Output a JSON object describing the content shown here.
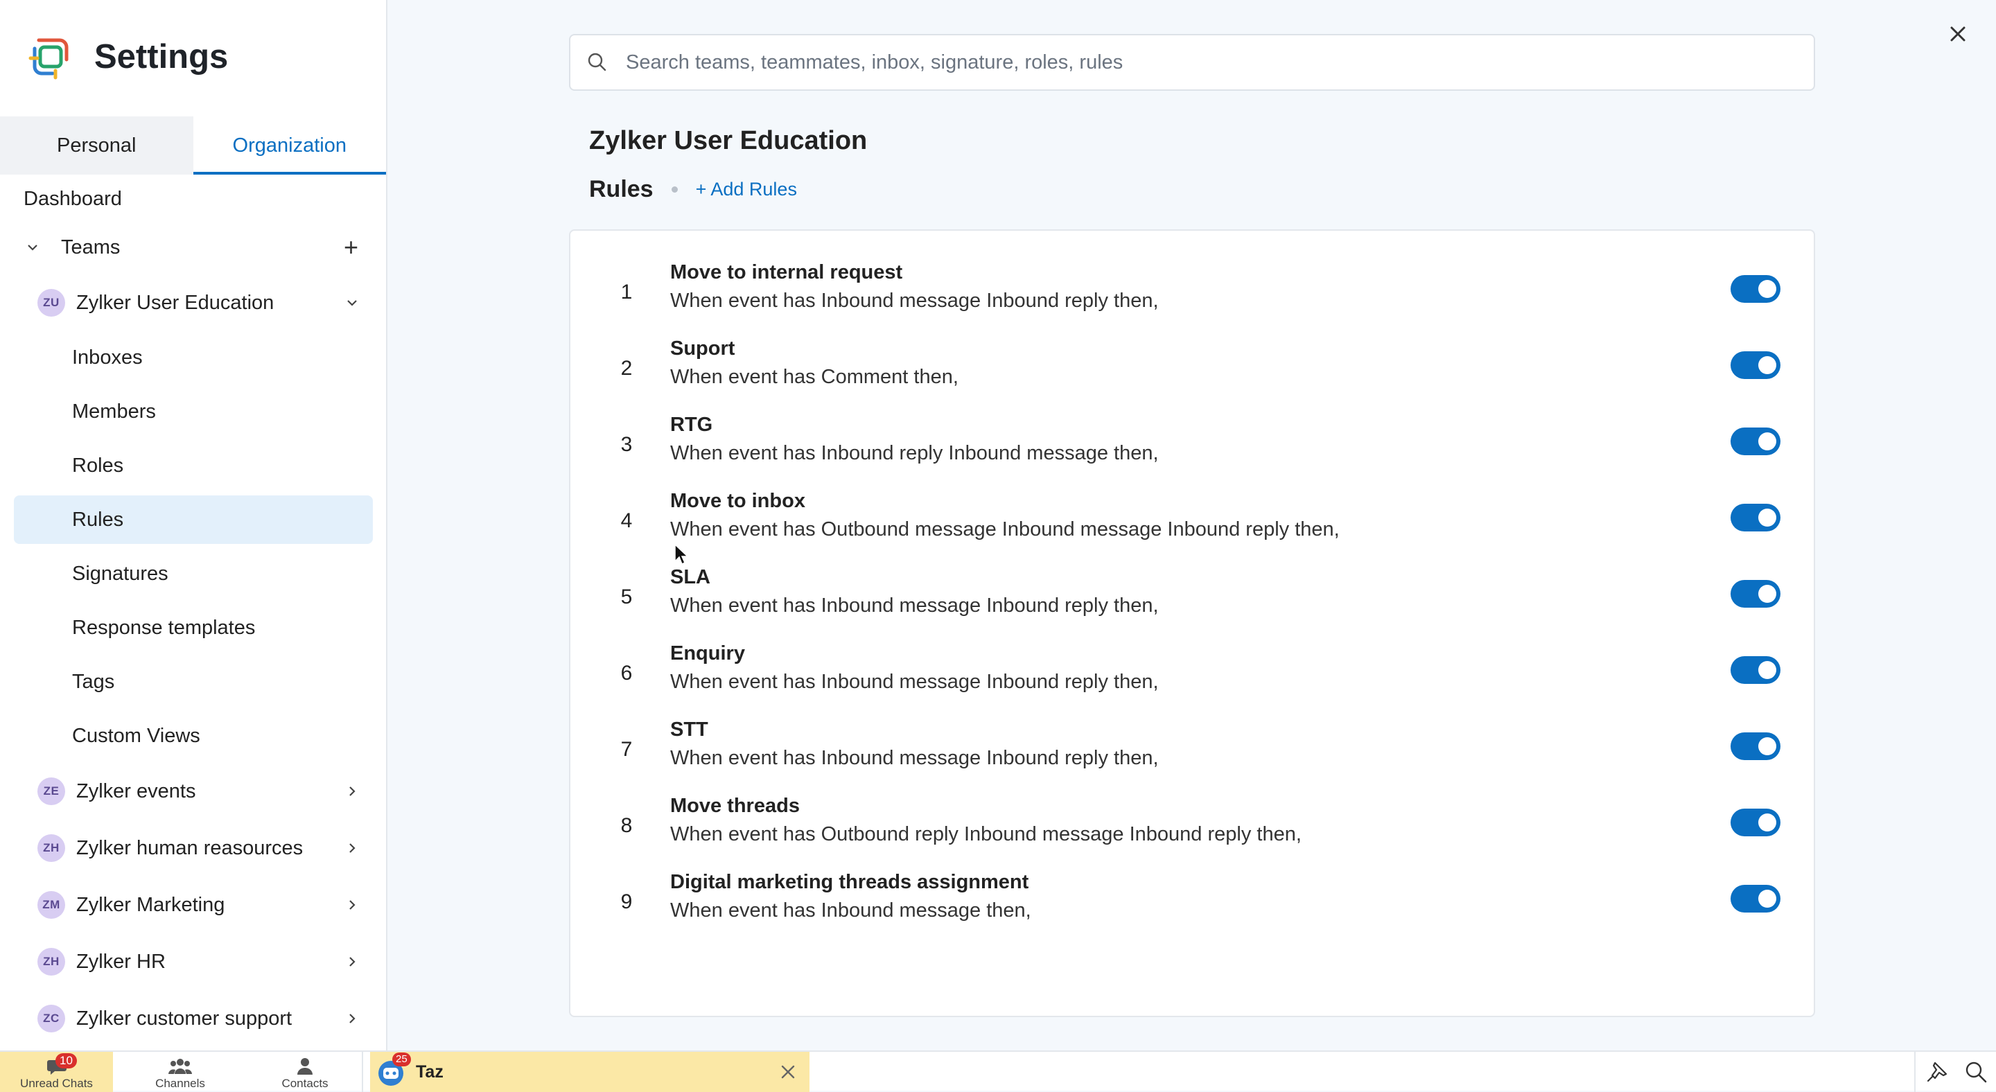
{
  "app": {
    "title": "Settings"
  },
  "tabs": [
    {
      "label": "Personal",
      "active": false
    },
    {
      "label": "Organization",
      "active": true
    }
  ],
  "sidebar": {
    "dashboard": "Dashboard",
    "teams_label": "Teams",
    "current_team": {
      "initials": "ZU",
      "name": "Zylker User Education"
    },
    "sub_items": [
      "Inboxes",
      "Members",
      "Roles",
      "Rules",
      "Signatures",
      "Response templates",
      "Tags",
      "Custom Views"
    ],
    "selected_sub_item": "Rules",
    "other_teams": [
      {
        "initials": "ZE",
        "name": "Zylker events"
      },
      {
        "initials": "ZH",
        "name": "Zylker human reasources"
      },
      {
        "initials": "ZM",
        "name": "Zylker Marketing"
      },
      {
        "initials": "ZH",
        "name": "Zylker HR"
      },
      {
        "initials": "ZC",
        "name": "Zylker customer support"
      }
    ]
  },
  "search": {
    "placeholder": "Search teams, teammates, inbox, signature, roles, rules",
    "value": ""
  },
  "main": {
    "team_title": "Zylker User Education",
    "section_label": "Rules",
    "add_label": "+ Add Rules",
    "rules": [
      {
        "num": "1",
        "name": "Move to internal request",
        "desc": "When event has Inbound message Inbound reply then,",
        "enabled": true
      },
      {
        "num": "2",
        "name": "Suport",
        "desc": "When event has Comment then,",
        "enabled": true
      },
      {
        "num": "3",
        "name": "RTG",
        "desc": "When event has Inbound reply Inbound message then,",
        "enabled": true
      },
      {
        "num": "4",
        "name": "Move to inbox",
        "desc": "When event has Outbound message Inbound message Inbound reply then,",
        "enabled": true
      },
      {
        "num": "5",
        "name": "SLA",
        "desc": "When event has Inbound message Inbound reply then,",
        "enabled": true
      },
      {
        "num": "6",
        "name": "Enquiry",
        "desc": "When event has Inbound message Inbound reply then,",
        "enabled": true
      },
      {
        "num": "7",
        "name": "STT",
        "desc": "When event has Inbound message Inbound reply then,",
        "enabled": true
      },
      {
        "num": "8",
        "name": "Move threads",
        "desc": "When event has Outbound reply Inbound message Inbound reply then,",
        "enabled": true
      },
      {
        "num": "9",
        "name": "Digital marketing threads assignment",
        "desc": "When event has Inbound message then,",
        "enabled": true
      }
    ]
  },
  "bottombar": {
    "unread_label": "Unread Chats",
    "unread_count": "10",
    "channels_label": "Channels",
    "contacts_label": "Contacts",
    "chat_name": "Taz",
    "chat_badge": "25"
  },
  "colors": {
    "accent": "#0a6fc2",
    "selected_bg": "#e3f0fb",
    "chat_bar": "#fbe8a6",
    "badge": "#d9302c"
  }
}
